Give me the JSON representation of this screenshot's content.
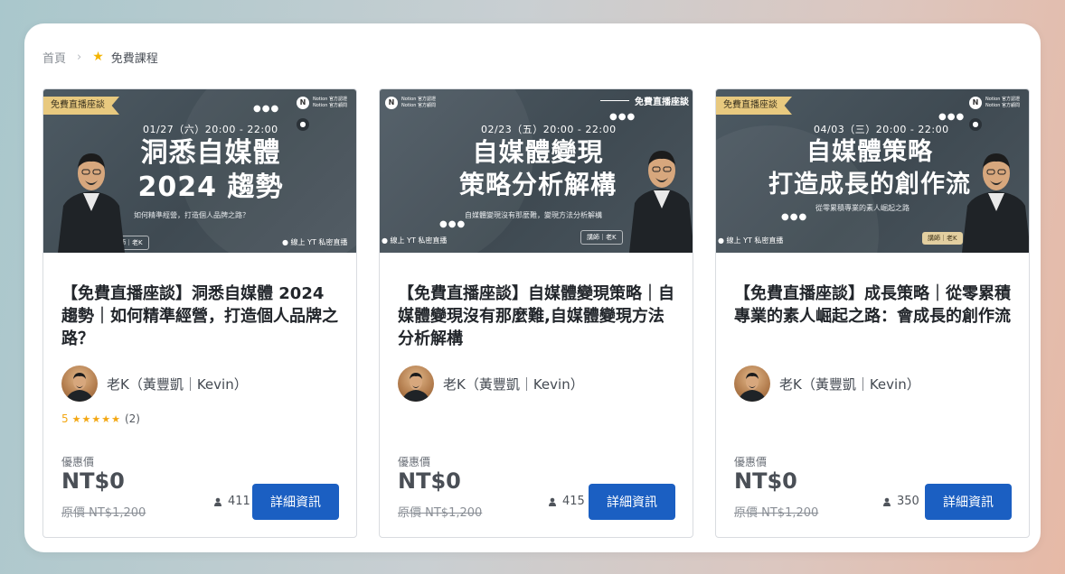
{
  "breadcrumb": {
    "home": "首頁",
    "current": "免費課程"
  },
  "courses": [
    {
      "thumb": {
        "ribbon": "免費直播座談",
        "date": "01/27（六）20:00 - 22:00",
        "line1": "洞悉自媒體",
        "line2": "2024 趨勢",
        "subtitle": "如何精準經營，打造個人品牌之路？",
        "tag": "講師｜老K",
        "live": "線上 YT 私密直播"
      },
      "title": "【免費直播座談】洞悉自媒體 2024 趨勢｜如何精準經營，打造個人品牌之路？",
      "author": "老K（黃豐凱｜Kevin）",
      "rating": {
        "score": "5",
        "stars": "★★★★★",
        "count": "(2)"
      },
      "price_label": "優惠價",
      "price": "NT$0",
      "original": "原價 NT$1,200",
      "students": "411",
      "button": "詳細資訊"
    },
    {
      "thumb": {
        "top_label": "免費直播座談",
        "date": "02/23（五）20:00 - 22:00",
        "line1": "自媒體變現",
        "line2": "策略分析解構",
        "subtitle": "自媒體變現沒有那麼難，變現方法分析解構",
        "tag": "講師｜老K",
        "live": "線上 YT 私密直播"
      },
      "title": "【免費直播座談】自媒體變現策略｜自媒體變現沒有那麼難,自媒體變現方法分析解構",
      "author": "老K（黃豐凱｜Kevin）",
      "price_label": "優惠價",
      "price": "NT$0",
      "original": "原價 NT$1,200",
      "students": "415",
      "button": "詳細資訊"
    },
    {
      "thumb": {
        "ribbon": "免費直播座談",
        "date": "04/03（三）20:00 - 22:00",
        "line1": "自媒體策略",
        "line2": "打造成長的創作流",
        "subtitle": "從零累積專業的素人崛起之路",
        "tag": "講師｜老K",
        "live": "線上 YT 私密直播"
      },
      "title": "【免費直播座談】成長策略｜從零累積專業的素人崛起之路：會成長的創作流",
      "author": "老K（黃豐凱｜Kevin）",
      "price_label": "優惠價",
      "price": "NT$0",
      "original": "原價 NT$1,200",
      "students": "350",
      "button": "詳細資訊"
    }
  ],
  "colors": {
    "button": "#1b5fc2",
    "star": "#f3a712",
    "thumb_bg": "#46525a"
  }
}
